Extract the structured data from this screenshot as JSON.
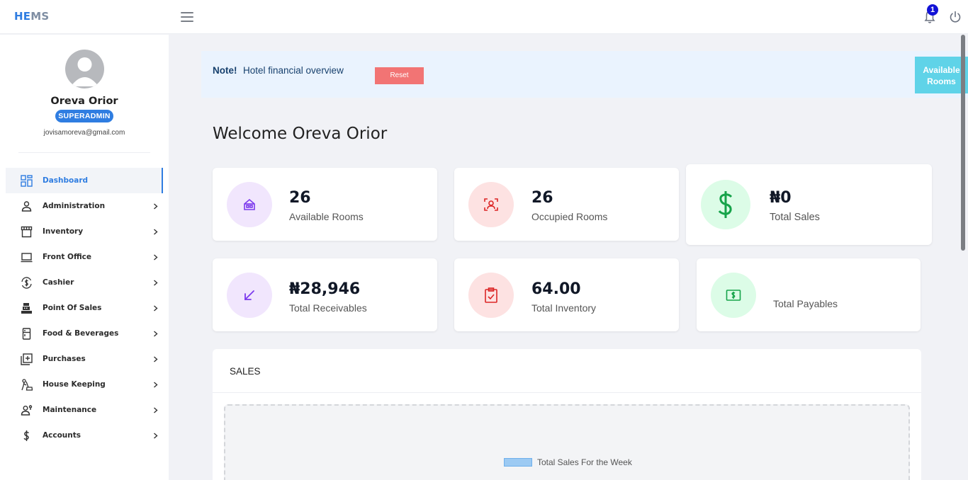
{
  "app": {
    "brand_part1": "HE",
    "brand_part2": "MS"
  },
  "header": {
    "notification_count": "1"
  },
  "user": {
    "name": "Oreva Orior",
    "role": "SUPERADMIN",
    "email": "jovisamoreva@gmail.com"
  },
  "sidebar": {
    "items": [
      {
        "label": "Dashboard",
        "icon": "dashboard-icon"
      },
      {
        "label": "Administration",
        "icon": "user-icon"
      },
      {
        "label": "Inventory",
        "icon": "store-icon"
      },
      {
        "label": "Front Office",
        "icon": "laptop-icon"
      },
      {
        "label": "Cashier",
        "icon": "cash-exchange-icon"
      },
      {
        "label": "Point Of Sales",
        "icon": "cash-register-icon"
      },
      {
        "label": "Food & Beverages",
        "icon": "fridge-icon"
      },
      {
        "label": "Purchases",
        "icon": "add-box-icon"
      },
      {
        "label": "House Keeping",
        "icon": "broom-icon"
      },
      {
        "label": "Maintenance",
        "icon": "worker-icon"
      },
      {
        "label": "Accounts",
        "icon": "dollar-icon"
      }
    ]
  },
  "note": {
    "strong": "Note!",
    "text": "Hotel financial overview",
    "reset_label": "Reset"
  },
  "available_rooms_tab": {
    "line1": "Available",
    "line2": "Rooms"
  },
  "welcome": "Welcome Oreva Orior",
  "cards": [
    {
      "value": "26",
      "label": "Available Rooms",
      "icon": "hotel-icon",
      "color": "#7c3aed"
    },
    {
      "value": "26",
      "label": "Occupied Rooms",
      "icon": "guest-icon",
      "color": "#dc2626"
    },
    {
      "value": "₦0",
      "label": "Total Sales",
      "icon": "dollar-icon",
      "color": "#16a34a"
    },
    {
      "value": "₦28,946",
      "label": "Total Receivables",
      "icon": "arrow-down-left-icon",
      "color": "#7c3aed"
    },
    {
      "value": "64.00",
      "label": "Total Inventory",
      "icon": "clipboard-check-icon",
      "color": "#dc2626"
    },
    {
      "value": "",
      "label": "Total Payables",
      "icon": "money-icon",
      "color": "#16a34a"
    }
  ],
  "sales": {
    "title": "SALES",
    "legend": "Total Sales For the Week"
  },
  "colors": {
    "accent": "#2f7de1",
    "reset": "#f27474",
    "tab": "#5fd3e8"
  }
}
